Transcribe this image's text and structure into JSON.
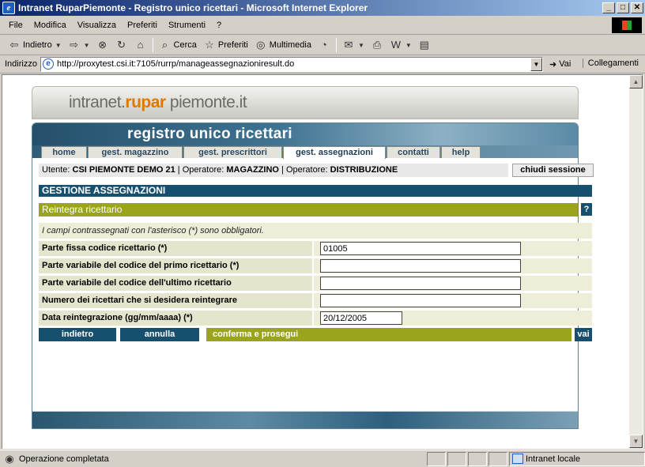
{
  "window": {
    "title": "Intranet RuparPiemonte - Registro unico ricettari - Microsoft Internet Explorer",
    "app_icon": "ie-icon",
    "controls": [
      "minimize",
      "maximize",
      "close"
    ]
  },
  "menubar": {
    "items": [
      "File",
      "Modifica",
      "Visualizza",
      "Preferiti",
      "Strumenti",
      "?"
    ]
  },
  "toolbar": {
    "back_label": "Indietro",
    "search_label": "Cerca",
    "favorites_label": "Preferiti",
    "media_label": "Multimedia"
  },
  "addressbar": {
    "label": "Indirizzo",
    "url": "http://proxytest.csi.it:7105/rurrp/manageassegnazioniresult.do",
    "go_label": "Vai",
    "links_label": "Collegamenti"
  },
  "page": {
    "brand_prefix": "intranet.",
    "brand_highlight": "rupar",
    "brand_suffix": " piemonte.it",
    "app_title": "registro unico ricettari",
    "tabs": [
      {
        "label": "home",
        "active": false
      },
      {
        "label": "gest. magazzino",
        "active": false
      },
      {
        "label": "gest. prescrittori",
        "active": false
      },
      {
        "label": "gest. assegnazioni",
        "active": true
      },
      {
        "label": "contatti",
        "active": false
      },
      {
        "label": "help",
        "active": false
      }
    ],
    "user_bar": {
      "user_label": "Utente:",
      "user_value": "CSI PIEMONTE DEMO 21",
      "operator_label": "Operatore:",
      "operator_value": "MAGAZZINO",
      "operator2_label": "Operatore:",
      "operator2_value": "DISTRIBUZIONE"
    },
    "logout_label": "chiudi sessione",
    "section_title": "GESTIONE ASSEGNAZIONI",
    "subsection_title": "Reintegra ricettario",
    "help_label": "?",
    "required_note": "I campi contrassegnati con l'asterisco (*) sono obbligatori.",
    "fields": [
      {
        "label": "Parte fissa codice ricettario (*)",
        "value": "01005"
      },
      {
        "label": "Parte variabile del codice del primo ricettario (*)",
        "value": ""
      },
      {
        "label": "Parte variabile del codice dell'ultimo ricettario",
        "value": ""
      },
      {
        "label": "Numero dei ricettari che si desidera reintegrare",
        "value": ""
      },
      {
        "label": "Data reintegrazione (gg/mm/aaaa) (*)",
        "value": "20/12/2005"
      }
    ],
    "buttons": {
      "back": "indietro",
      "cancel": "annulla",
      "confirm": "conferma e prosegui",
      "go": "vai"
    }
  },
  "statusbar": {
    "status_text": "Operazione completata",
    "zone_label": "Intranet locale"
  },
  "colors": {
    "section_blue": "#174f6e",
    "olive": "#9aa41c",
    "brand_orange": "#e07800"
  }
}
